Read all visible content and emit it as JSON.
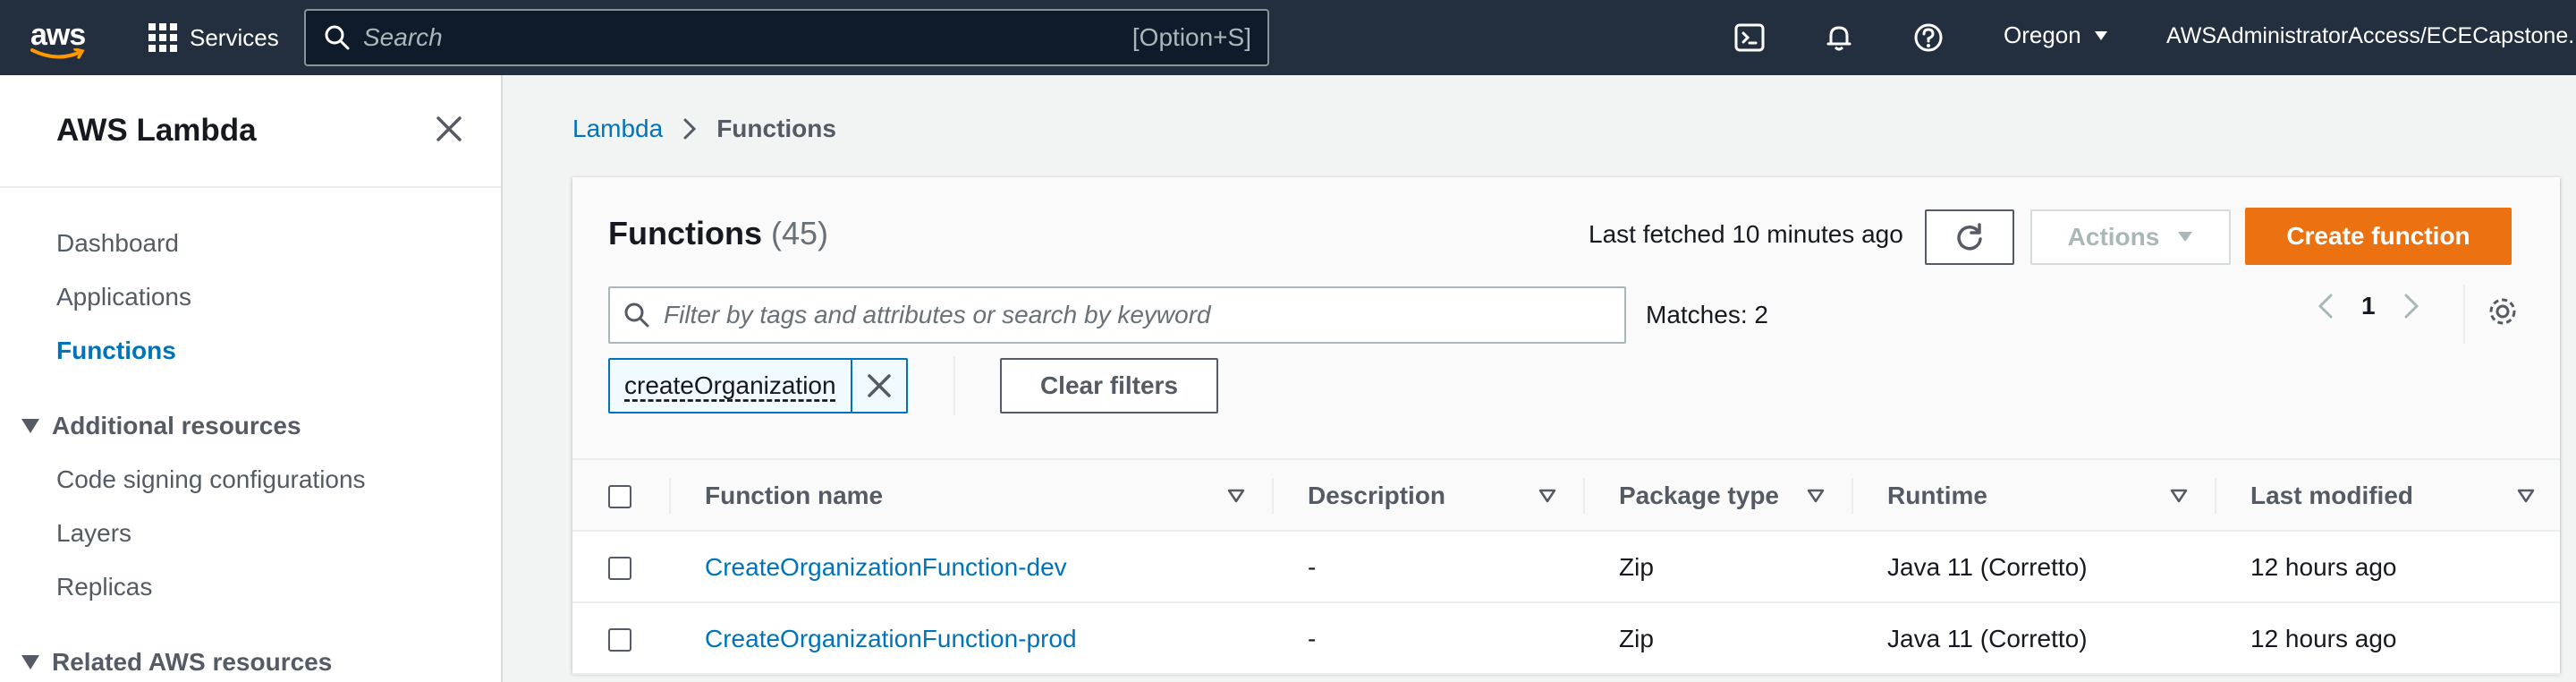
{
  "topnav": {
    "logo_text": "aws",
    "services_label": "Services",
    "search_placeholder": "Search",
    "search_shortcut": "[Option+S]",
    "region": "Oregon",
    "account": "AWSAdministratorAccess/ECECapstone.Da"
  },
  "sidebar": {
    "title": "AWS Lambda",
    "items": [
      {
        "label": "Dashboard",
        "active": false
      },
      {
        "label": "Applications",
        "active": false
      },
      {
        "label": "Functions",
        "active": true
      }
    ],
    "additional_resources": {
      "label": "Additional resources",
      "items": [
        "Code signing configurations",
        "Layers",
        "Replicas"
      ]
    },
    "related": {
      "label": "Related AWS resources"
    }
  },
  "breadcrumb": {
    "parent": "Lambda",
    "current": "Functions"
  },
  "panel": {
    "title": "Functions",
    "count": "(45)",
    "last_fetched": "Last fetched 10 minutes ago",
    "actions_label": "Actions",
    "create_label": "Create function",
    "filter_placeholder": "Filter by tags and attributes or search by keyword",
    "matches": "Matches: 2",
    "page": "1",
    "token": "createOrganization",
    "clear_filters": "Clear filters"
  },
  "table": {
    "columns": [
      "Function name",
      "Description",
      "Package type",
      "Runtime",
      "Last modified"
    ],
    "rows": [
      {
        "name": "CreateOrganizationFunction-dev",
        "description": "-",
        "package_type": "Zip",
        "runtime": "Java 11 (Corretto)",
        "last_modified": "12 hours ago"
      },
      {
        "name": "CreateOrganizationFunction-prod",
        "description": "-",
        "package_type": "Zip",
        "runtime": "Java 11 (Corretto)",
        "last_modified": "12 hours ago"
      }
    ]
  },
  "colors": {
    "nav_bg": "#232f3e",
    "link": "#0073bb",
    "primary_button": "#ec7211"
  }
}
